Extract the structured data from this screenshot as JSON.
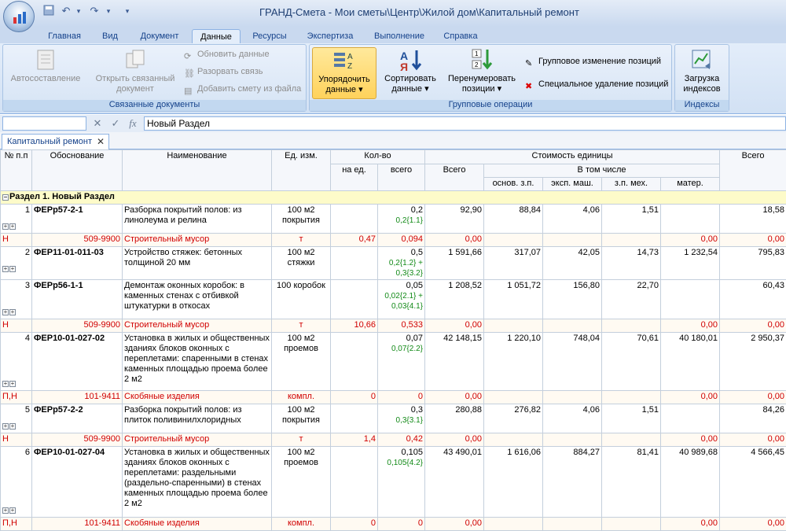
{
  "window": {
    "title": "ГРАНД-Смета - Мои сметы\\Центр\\Жилой дом\\Капитальный ремонт"
  },
  "tabs": [
    "Главная",
    "Вид",
    "Документ",
    "Данные",
    "Ресурсы",
    "Экспертиза",
    "Выполнение",
    "Справка"
  ],
  "active_tab": "Данные",
  "ribbon": {
    "linked": {
      "caption": "Связанные документы",
      "autocompose": "Автосоставление",
      "open_linked": "Открыть связанный документ",
      "update": "Обновить данные",
      "break_link": "Разорвать связь",
      "add_from_file": "Добавить смету из файла"
    },
    "group_ops": {
      "caption": "Групповые операции",
      "order": "Упорядочить данные",
      "sort": "Сортировать данные",
      "renumber": "Перенумеровать позиции",
      "group_change": "Групповое изменение позиций",
      "special_delete": "Специальное удаление позиций"
    },
    "indexes": {
      "caption": "Индексы",
      "load": "Загрузка индексов"
    }
  },
  "formula_bar": {
    "value": "Новый Раздел"
  },
  "doc_tab": "Капитальный ремонт",
  "columns": {
    "num": "№ п.п",
    "basis": "Обоснование",
    "name": "Наименование",
    "unit": "Ед. изм.",
    "qty": "Кол-во",
    "qty_per": "на ед.",
    "qty_total": "всего",
    "unit_cost": "Стоимость единицы",
    "total": "Всего",
    "incl": "В том числе",
    "zp": "основ. з.п.",
    "mach": "эксп. маш.",
    "zpmech": "з.п. мех.",
    "mat": "матер.",
    "total2": "Всего"
  },
  "section": "Раздел 1. Новый Раздел",
  "rows": [
    {
      "type": "pos",
      "num": "1",
      "code": "ФЕРр57-2-1",
      "name": "Разборка покрытий полов: из линолеума и релина",
      "unit": "100 м2 покрытия",
      "qty_total": "0,2",
      "formula": "0,2{1.1}",
      "total": "92,90",
      "zp": "88,84",
      "mach": "4,06",
      "zpmech": "1,51",
      "mat": "",
      "total2": "18,58"
    },
    {
      "type": "res",
      "kind": "Н",
      "code": "509-9900",
      "name": "Строительный мусор",
      "unit": "т",
      "qty_per": "0,47",
      "qty_total": "0,094",
      "total": "0,00",
      "mat": "0,00",
      "total2": "0,00"
    },
    {
      "type": "pos",
      "num": "2",
      "code": "ФЕР11-01-011-03",
      "name": "Устройство стяжек: бетонных толщиной 20 мм",
      "unit": "100 м2 стяжки",
      "qty_total": "0,5",
      "formula": "0,2{1.2} + 0,3{3.2}",
      "total": "1 591,66",
      "zp": "317,07",
      "mach": "42,05",
      "zpmech": "14,73",
      "mat": "1 232,54",
      "total2": "795,83"
    },
    {
      "type": "pos",
      "num": "3",
      "code": "ФЕРр56-1-1",
      "name": "Демонтаж оконных коробок: в каменных стенах с отбивкой штукатурки в откосах",
      "unit": "100 коробок",
      "qty_total": "0,05",
      "formula": "0,02{2.1} + 0,03{4.1}",
      "total": "1 208,52",
      "zp": "1 051,72",
      "mach": "156,80",
      "zpmech": "22,70",
      "mat": "",
      "total2": "60,43"
    },
    {
      "type": "res",
      "kind": "Н",
      "code": "509-9900",
      "name": "Строительный мусор",
      "unit": "т",
      "qty_per": "10,66",
      "qty_total": "0,533",
      "total": "0,00",
      "mat": "0,00",
      "total2": "0,00"
    },
    {
      "type": "pos",
      "num": "4",
      "code": "ФЕР10-01-027-02",
      "name": "Установка в жилых и общественных зданиях блоков оконных с переплетами: спаренными в стенах каменных площадью проема более 2 м2",
      "unit": "100 м2 проемов",
      "qty_total": "0,07",
      "formula": "0,07{2.2}",
      "total": "42 148,15",
      "zp": "1 220,10",
      "mach": "748,04",
      "zpmech": "70,61",
      "mat": "40 180,01",
      "total2": "2 950,37"
    },
    {
      "type": "res",
      "kind": "П,Н",
      "code": "101-9411",
      "name": "Скобяные изделия",
      "unit": "компл.",
      "qty_per": "0",
      "qty_total": "0",
      "total": "0,00",
      "mat": "0,00",
      "total2": "0,00"
    },
    {
      "type": "pos",
      "num": "5",
      "code": "ФЕРр57-2-2",
      "name": "Разборка покрытий полов: из плиток поливинилхлоридных",
      "unit": "100 м2 покрытия",
      "qty_total": "0,3",
      "formula": "0,3{3.1}",
      "total": "280,88",
      "zp": "276,82",
      "mach": "4,06",
      "zpmech": "1,51",
      "mat": "",
      "total2": "84,26"
    },
    {
      "type": "res",
      "kind": "Н",
      "code": "509-9900",
      "name": "Строительный мусор",
      "unit": "т",
      "qty_per": "1,4",
      "qty_total": "0,42",
      "total": "0,00",
      "mat": "0,00",
      "total2": "0,00"
    },
    {
      "type": "pos",
      "num": "6",
      "code": "ФЕР10-01-027-04",
      "name": "Установка в жилых и общественных зданиях блоков оконных с переплетами: раздельными (раздельно-спаренными) в стенах каменных площадью проема более 2 м2",
      "unit": "100 м2 проемов",
      "qty_total": "0,105",
      "formula": "0,105{4.2}",
      "total": "43 490,01",
      "zp": "1 616,06",
      "mach": "884,27",
      "zpmech": "81,41",
      "mat": "40 989,68",
      "total2": "4 566,45"
    },
    {
      "type": "res",
      "kind": "П,Н",
      "code": "101-9411",
      "name": "Скобяные изделия",
      "unit": "компл.",
      "qty_per": "0",
      "qty_total": "0",
      "total": "0,00",
      "mat": "0,00",
      "total2": "0,00"
    }
  ]
}
